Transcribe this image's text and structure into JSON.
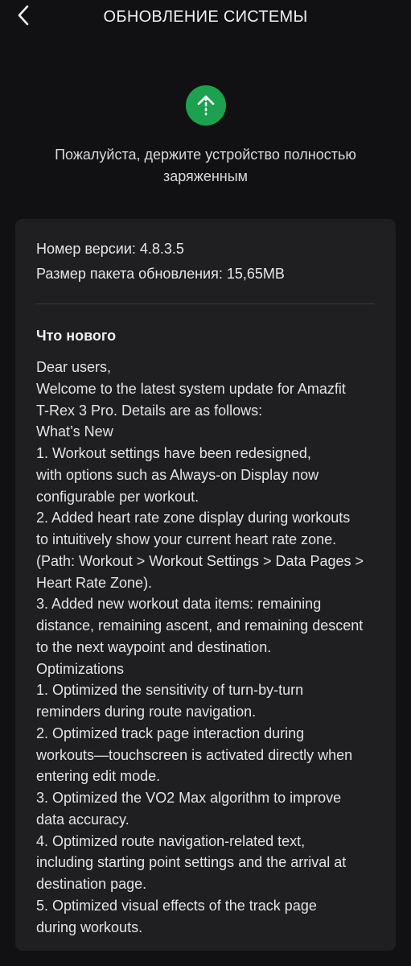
{
  "header": {
    "title": "ОБНОВЛЕНИЕ СИСТЕМЫ",
    "back_icon": "chevron-left-icon"
  },
  "status": {
    "icon": "upload-arrow-icon",
    "icon_color": "#1ca14f",
    "notice_line1": "Пожалуйста, держите устройство полностью",
    "notice_line2": "заряженным"
  },
  "info": {
    "version": "Номер версии: 4.8.3.5",
    "package_size": "Размер пакета обновления: 15,65MB"
  },
  "whats_new": {
    "title": "Что нового",
    "lines": [
      "Dear users,",
      "Welcome to the latest system update for Amazfit",
      "T-Rex 3 Pro. Details are as follows:",
      "What’s New",
      "1.  Workout settings have been redesigned,",
      "with options such as Always-on Display now",
      "configurable per workout.",
      "2.  Added heart rate zone display during workouts",
      "to intuitively show your current heart rate zone.",
      "(Path: Workout > Workout Settings > Data Pages >",
      "Heart Rate Zone).",
      "3. Added new workout data items: remaining",
      "distance, remaining ascent, and remaining descent",
      "to the next waypoint and destination.",
      "Optimizations",
      "1.  Optimized the sensitivity of turn-by-turn",
      "reminders during route navigation.",
      "2.  Optimized track page interaction during",
      "workouts—touchscreen is activated directly when",
      "entering edit mode.",
      "3.  Optimized the VO2 Max algorithm to improve",
      "data accuracy.",
      "4.  Optimized route navigation-related text,",
      "including starting point settings and the arrival at",
      "destination page.",
      "5.  Optimized visual effects of the track page",
      "during workouts."
    ]
  }
}
